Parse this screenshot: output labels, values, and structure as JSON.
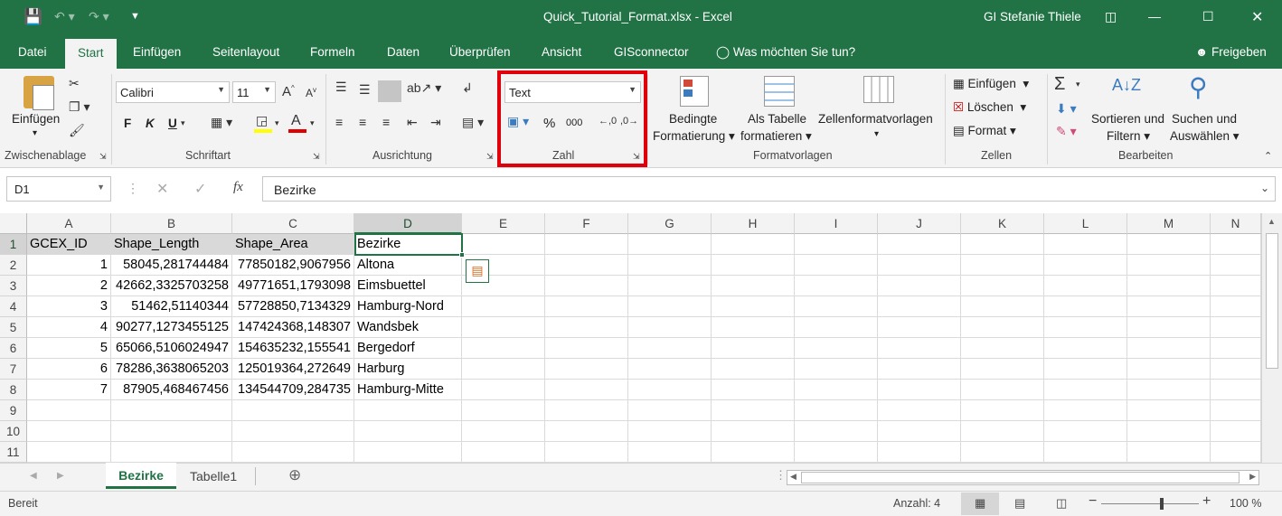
{
  "titlebar": {
    "filename": "Quick_Tutorial_Format.xlsx",
    "separator": "-",
    "app": "Excel",
    "user": "GI Stefanie Thiele"
  },
  "tabs": [
    "Datei",
    "Start",
    "Einfügen",
    "Seitenlayout",
    "Formeln",
    "Daten",
    "Überprüfen",
    "Ansicht",
    "GISconnector"
  ],
  "tell_me": "Was möchten Sie tun?",
  "share": "Freigeben",
  "ribbon": {
    "clipboard": {
      "paste": "Einfügen",
      "label": "Zwischenablage"
    },
    "font": {
      "name": "Calibri",
      "size": "11",
      "bold": "F",
      "italic": "K",
      "underline": "U",
      "label": "Schriftart"
    },
    "alignment": {
      "label": "Ausrichtung"
    },
    "number": {
      "format": "Text",
      "percent": "%",
      "thousands": "000",
      "label": "Zahl"
    },
    "styles": {
      "conditional_1": "Bedingte",
      "conditional_2": "Formatierung",
      "table_1": "Als Tabelle",
      "table_2": "formatieren",
      "cellstyles": "Zellenformatvorlagen",
      "label": "Formatvorlagen"
    },
    "cells": {
      "insert": "Einfügen",
      "delete": "Löschen",
      "format": "Format",
      "label": "Zellen"
    },
    "editing": {
      "sort_1": "Sortieren und",
      "sort_2": "Filtern",
      "find_1": "Suchen und",
      "find_2": "Auswählen",
      "label": "Bearbeiten"
    }
  },
  "formula_bar": {
    "name_box": "D1",
    "fx": "fx",
    "content": "Bezirke"
  },
  "columns": [
    "A",
    "B",
    "C",
    "D",
    "E",
    "F",
    "G",
    "H",
    "I",
    "J",
    "K",
    "L",
    "M",
    "N"
  ],
  "rows": [
    "1",
    "2",
    "3",
    "4",
    "5",
    "6",
    "7",
    "8",
    "9",
    "10",
    "11"
  ],
  "table": {
    "headers": [
      "GCEX_ID",
      "Shape_Length",
      "Shape_Area",
      "Bezirke"
    ],
    "data": [
      [
        "1",
        "58045,281744484",
        "77850182,9067956",
        "Altona"
      ],
      [
        "2",
        "42662,3325703258",
        "49771651,1793098",
        "Eimsbuettel"
      ],
      [
        "3",
        "51462,51140344",
        "57728850,7134329",
        "Hamburg-Nord"
      ],
      [
        "4",
        "90277,1273455125",
        "147424368,148307",
        "Wandsbek"
      ],
      [
        "5",
        "65066,5106024947",
        "154635232,155541",
        "Bergedorf"
      ],
      [
        "6",
        "78286,3638065203",
        "125019364,272649",
        "Harburg"
      ],
      [
        "7",
        "87905,468467456",
        "134544709,284735",
        "Hamburg-Mitte"
      ]
    ]
  },
  "sheets": {
    "active": "Bezirke",
    "other": "Tabelle1"
  },
  "status": {
    "mode": "Bereit",
    "count": "Anzahl: 4",
    "zoom": "100 %"
  }
}
